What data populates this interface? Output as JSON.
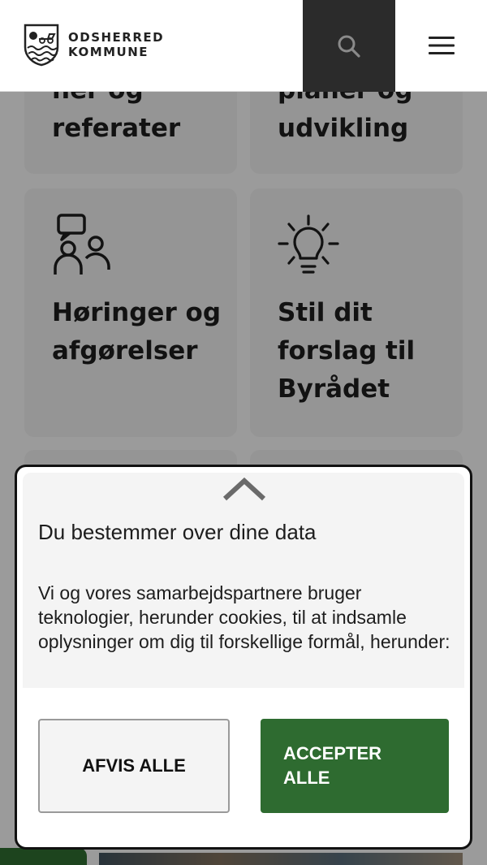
{
  "header": {
    "logo_line1": "ODSHERRED",
    "logo_line2": "KOMMUNE",
    "search_icon": "search-icon",
    "menu_icon": "hamburger-menu-icon"
  },
  "tiles": [
    {
      "label_line1": "ner og",
      "label_line2": "referater"
    },
    {
      "label_line1": "planer og",
      "label_line2": "udvikling"
    },
    {
      "label_line1": "Høringer og",
      "label_line2": "afgørelser",
      "icon": "people-speech-icon"
    },
    {
      "label_line1": "Stil dit",
      "label_line2": "forslag til",
      "label_line3": "Byrådet",
      "icon": "lightbulb-icon"
    }
  ],
  "cookie_dialog": {
    "expand_icon": "chevron-up-icon",
    "title": "Du bestemmer over dine data",
    "body": "Vi og vores samarbejdspartnere bruger teknologier, herunder cookies, til at indsamle oplysninger om dig til forskellige formål, herunder:",
    "reject_label": "AFVIS ALLE",
    "accept_label": "ACCEPTER ALLE"
  },
  "colors": {
    "accent_green": "#2e6b30",
    "header_search_bg": "#2b2b2b",
    "tile_bg": "#e9e9e9"
  }
}
